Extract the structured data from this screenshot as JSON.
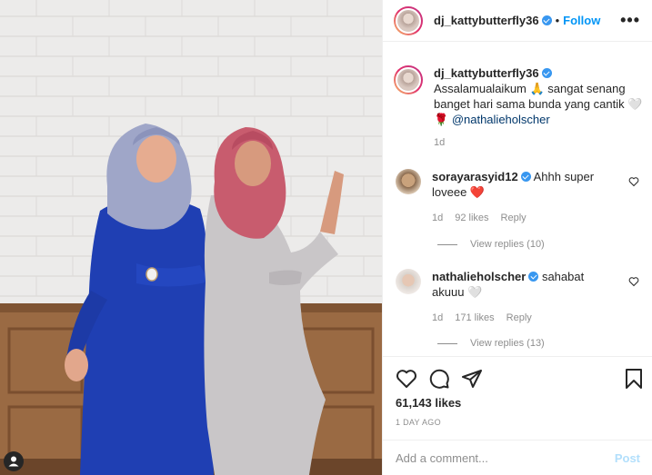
{
  "post": {
    "username": "dj_kattybutterfly36",
    "dot": "•",
    "follow_label": "Follow",
    "more_label": "•••",
    "caption_text": "Assalamualaikum 🙏 sangat senang banget hari sama bunda yang cantik 🤍🌹",
    "caption_mention": "@nathalieholscher",
    "caption_time": "1d",
    "likes": "61,143 likes",
    "date": "1 DAY AGO",
    "comment_placeholder": "Add a comment...",
    "post_label": "Post"
  },
  "comments": [
    {
      "username": "sorayarasyid12",
      "text": "Ahhh super loveee ❤️",
      "time": "1d",
      "likes": "92 likes",
      "reply": "Reply",
      "view_replies": "View replies (10)"
    },
    {
      "username": "nathalieholscher",
      "text": "sahabat akuuu 🤍",
      "time": "1d",
      "likes": "171 likes",
      "reply": "Reply",
      "view_replies": "View replies (13)"
    }
  ],
  "icons": [
    "more-icon",
    "verified-icon",
    "heart-icon",
    "comment-icon",
    "share-icon",
    "bookmark-icon",
    "user-tag-icon"
  ],
  "colors": {
    "link": "#0095f6",
    "mention": "#00376b",
    "muted": "#8e8e8e",
    "post_disabled": "#b2dffc"
  }
}
